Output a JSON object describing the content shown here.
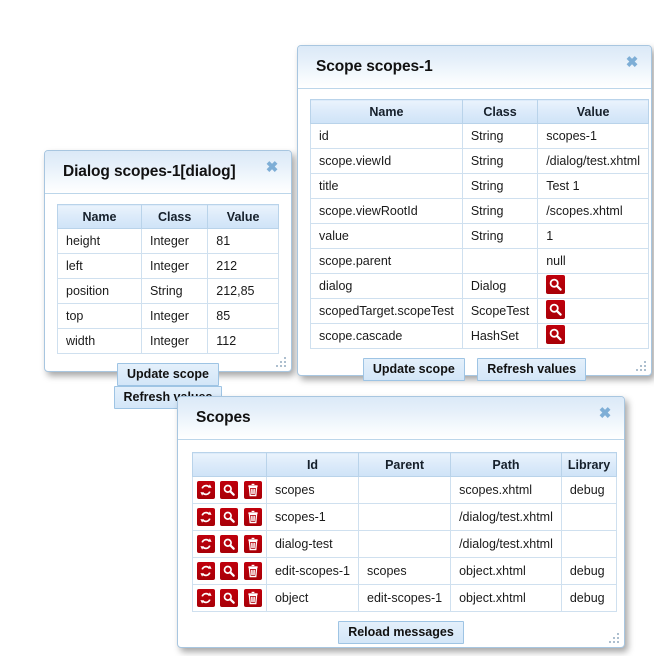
{
  "theme": {
    "accent_blue": "#7eaed6",
    "header_gradient_top": "#dbe9f7",
    "table_header_blue": "#dbeafa",
    "icon_red": "#b00008",
    "border_blue": "#a8c6e0"
  },
  "icons": {
    "close": "close-icon",
    "magnifier": "magnifier-icon",
    "refresh": "refresh-icon",
    "trash": "trash-icon",
    "grip": "resize-grip-icon",
    "close_glyph": "✖"
  },
  "dialog_scope_panel": {
    "title": "Dialog scopes-1[dialog]",
    "columns": [
      "Name",
      "Class",
      "Value"
    ],
    "rows": [
      {
        "name": "height",
        "class": "Integer",
        "value": "81"
      },
      {
        "name": "left",
        "class": "Integer",
        "value": "212"
      },
      {
        "name": "position",
        "class": "String",
        "value": "212,85"
      },
      {
        "name": "top",
        "class": "Integer",
        "value": "85"
      },
      {
        "name": "width",
        "class": "Integer",
        "value": "112"
      }
    ],
    "buttons": {
      "update": "Update scope",
      "refresh": "Refresh values"
    }
  },
  "scope_panel": {
    "title": "Scope scopes-1",
    "columns": [
      "Name",
      "Class",
      "Value"
    ],
    "rows": [
      {
        "name": "id",
        "class": "String",
        "value": "scopes-1",
        "value_icon": ""
      },
      {
        "name": "scope.viewId",
        "class": "String",
        "value": "/dialog/test.xhtml",
        "value_icon": ""
      },
      {
        "name": "title",
        "class": "String",
        "value": "Test 1",
        "value_icon": ""
      },
      {
        "name": "scope.viewRootId",
        "class": "String",
        "value": "/scopes.xhtml",
        "value_icon": ""
      },
      {
        "name": "value",
        "class": "String",
        "value": "1",
        "value_icon": ""
      },
      {
        "name": "scope.parent",
        "class": "",
        "value": "null",
        "value_icon": ""
      },
      {
        "name": "dialog",
        "class": "Dialog",
        "value": "",
        "value_icon": "magnifier-icon"
      },
      {
        "name": "scopedTarget.scopeTest",
        "class": "ScopeTest",
        "value": "",
        "value_icon": "magnifier-icon"
      },
      {
        "name": "scope.cascade",
        "class": "HashSet",
        "value": "",
        "value_icon": "magnifier-icon"
      }
    ],
    "buttons": {
      "update": "Update scope",
      "refresh": "Refresh values"
    }
  },
  "scopes_panel": {
    "title": "Scopes",
    "columns": [
      "",
      "Id",
      "Parent",
      "Path",
      "Library"
    ],
    "rows": [
      {
        "id": "scopes",
        "parent": "",
        "path": "scopes.xhtml",
        "library": "debug"
      },
      {
        "id": "scopes-1",
        "parent": "",
        "path": "/dialog/test.xhtml",
        "library": ""
      },
      {
        "id": "dialog-test",
        "parent": "",
        "path": "/dialog/test.xhtml",
        "library": ""
      },
      {
        "id": "edit-scopes-1",
        "parent": "scopes",
        "path": "object.xhtml",
        "library": "debug"
      },
      {
        "id": "object",
        "parent": "edit-scopes-1",
        "path": "object.xhtml",
        "library": "debug"
      }
    ],
    "row_actions": [
      "refresh-icon",
      "magnifier-icon",
      "trash-icon"
    ],
    "buttons": {
      "reload": "Reload messages"
    }
  }
}
